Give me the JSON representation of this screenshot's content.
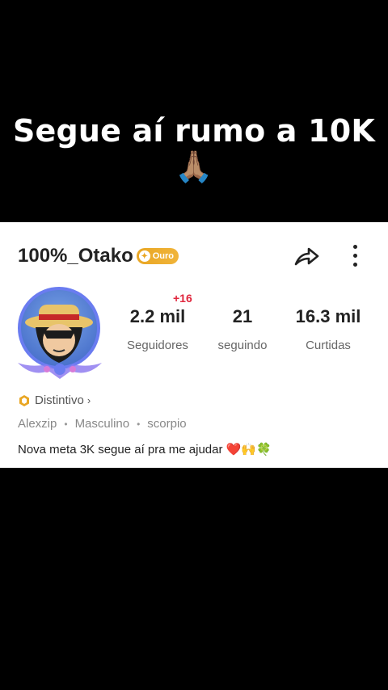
{
  "caption": "Segue aí rumo a 10K🙏🏽",
  "profile": {
    "username": "100%_Otako",
    "badge_label": "Ouro",
    "badge_color": "#E9A623",
    "followers_delta": "+16",
    "stats": [
      {
        "value": "2.2 mil",
        "label": "Seguidores"
      },
      {
        "value": "21",
        "label": "seguindo"
      },
      {
        "value": "16.3 mil",
        "label": "Curtidas"
      }
    ],
    "distintivo": "Distintivo",
    "details": [
      "Alexzip",
      "Masculino",
      "scorpio"
    ],
    "bio": "Nova meta 3K segue aí pra me ajudar ❤️🙌🍀"
  },
  "icons": [
    "share-icon",
    "more-icon",
    "distintivo-icon",
    "chevron-right-icon"
  ],
  "colors": {
    "accent_red": "#E0263D",
    "frame": "#6A7CF0"
  }
}
